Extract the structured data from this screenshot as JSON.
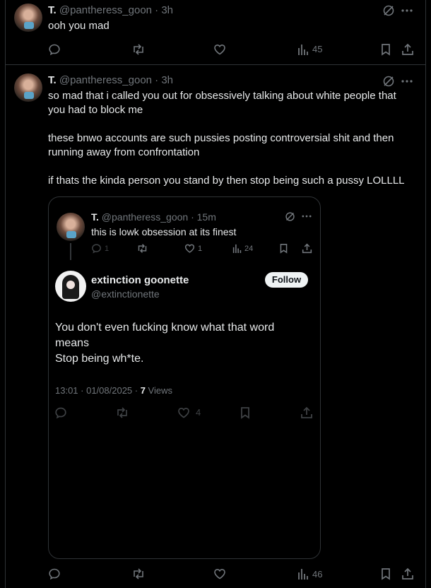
{
  "posts": [
    {
      "name": "T.",
      "handle": "@pantheress_goon · 3h",
      "text": "ooh you mad",
      "views": "45"
    },
    {
      "name": "T.",
      "handle": "@pantheress_goon · 3h",
      "text_lines": [
        "so mad that i called you out for obsessively talking about white people that",
        "you had to block me",
        "these bnwo accounts are such pussies posting controversial shit and then",
        "running away from confrontation",
        "if thats the kinda person you stand by then stop being such a pussy LOLLLL"
      ],
      "views": "46"
    }
  ],
  "quote": {
    "parent": {
      "name": "T.",
      "handle": "@pantheress_goon · 15m",
      "text": "this is lowk obsession at its finest",
      "replies": "1",
      "likes": "1",
      "views": "24"
    },
    "main": {
      "name": "extinction goonette",
      "handle": "@extinctionette",
      "follow_label": "Follow",
      "text_lines": [
        "You don't even fucking know what that word",
        "means",
        "Stop being wh*te."
      ],
      "timestamp": "13:01 · 01/08/2025 · ",
      "views_count": "7",
      "views_label": " Views",
      "likes": "4"
    }
  },
  "colors": {
    "background": "#000000",
    "text": "#e7e9ea",
    "muted": "#71767b",
    "border": "#2f3336"
  }
}
